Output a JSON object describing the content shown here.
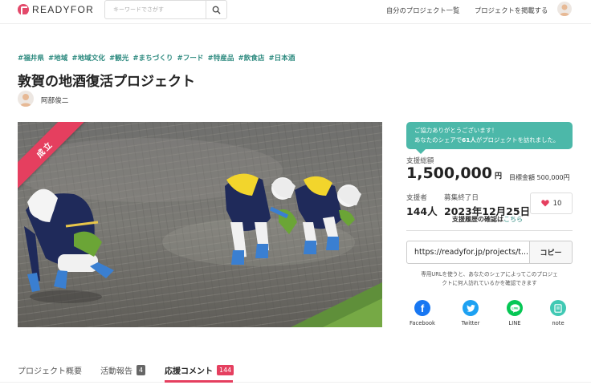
{
  "header": {
    "logo_text": "READYFOR",
    "search_placeholder": "キーワードでさがす",
    "nav_my_projects": "自分のプロジェクト一覧",
    "nav_post_project": "プロジェクトを掲載する"
  },
  "project": {
    "tags": [
      "#福井県",
      "#地域",
      "#地域文化",
      "#観光",
      "#まちづくり",
      "#フード",
      "#特産品",
      "#飲食店",
      "#日本酒"
    ],
    "title": "敦賀の地酒復活プロジェクト",
    "author": "阿部俊二",
    "status_ribbon": "成立"
  },
  "stats": {
    "bubble_line1": "ご協力ありがとうございます！",
    "bubble_line2_prefix": "あなたのシェアで",
    "bubble_line2_count": "61人",
    "bubble_line2_suffix": "がプロジェクトを訪れました。",
    "total_label": "支援総額",
    "total_amount": "1,500,000",
    "total_unit": "円",
    "goal_label": "目標金額",
    "goal_amount": "500,000円",
    "supporters_label": "支援者",
    "supporters_value": "144人",
    "deadline_label": "募集終了日",
    "deadline_value": "2023年12月25日",
    "history_text": "支援履歴の確認は",
    "history_link": "こちら",
    "like_count": "10"
  },
  "share": {
    "url": "https://readyfor.jp/projects/t...",
    "copy_label": "コピー",
    "note_line1": "専用URLを使うと、あなたのシェアによってこのプロジェ",
    "note_line2": "クトに何人訪れているかを確認できます",
    "buttons": [
      {
        "label": "Facebook",
        "icon": "facebook-icon",
        "color": "#1877f2"
      },
      {
        "label": "Twitter",
        "icon": "twitter-icon",
        "color": "#1da1f2"
      },
      {
        "label": "LINE",
        "icon": "line-icon",
        "color": "#06c755"
      },
      {
        "label": "note",
        "icon": "note-icon",
        "color": "#41c9b4"
      }
    ]
  },
  "tabs": [
    {
      "label": "プロジェクト概要",
      "count": ""
    },
    {
      "label": "活動報告",
      "count": "4"
    },
    {
      "label": "応援コメント",
      "count": "144"
    }
  ],
  "colors": {
    "brand_pink": "#e53f5f",
    "accent_teal": "#4cb8a9",
    "tag_teal": "#2d8a7f"
  }
}
